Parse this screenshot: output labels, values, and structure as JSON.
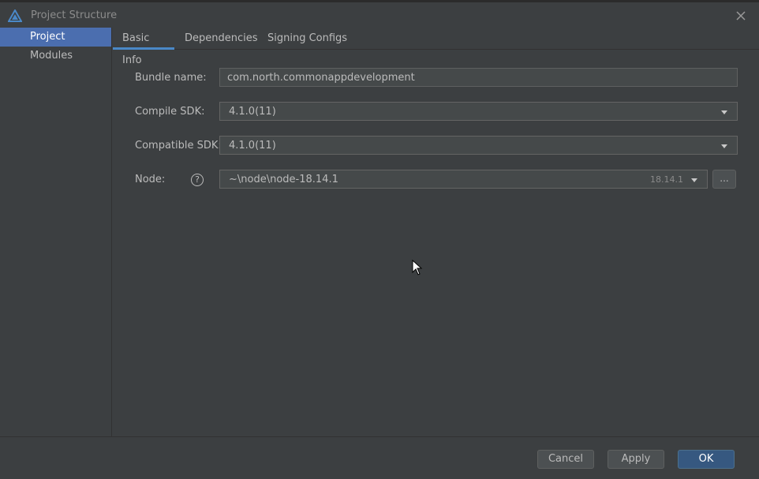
{
  "window": {
    "title": "Project Structure",
    "accent_color": "#4b6eaf"
  },
  "sidebar": {
    "items": [
      {
        "label": "Project",
        "selected": true
      },
      {
        "label": "Modules",
        "selected": false
      }
    ]
  },
  "tabs": [
    {
      "label": "Basic Info",
      "active": true
    },
    {
      "label": "Dependencies",
      "active": false
    },
    {
      "label": "Signing Configs",
      "active": false
    }
  ],
  "form": {
    "bundle_name": {
      "label": "Bundle name:",
      "value": "com.north.commonappdevelopment"
    },
    "compile_sdk": {
      "label": "Compile SDK:",
      "value": "4.1.0(11)"
    },
    "compatible_sdk": {
      "label": "Compatible SDK:",
      "value": "4.1.0(11)"
    },
    "node": {
      "label": "Node:",
      "help_glyph": "?",
      "value": "~\\node\\node-18.14.1",
      "version": "18.14.1",
      "browse_label": "..."
    }
  },
  "footer": {
    "cancel_label": "Cancel",
    "apply_label": "Apply",
    "ok_label": "OK"
  },
  "icons": {
    "app": "harmony-logo-icon",
    "close": "close-icon",
    "dropdown": "chevron-down-icon",
    "help": "help-icon",
    "cursor": "mouse-pointer-icon"
  }
}
